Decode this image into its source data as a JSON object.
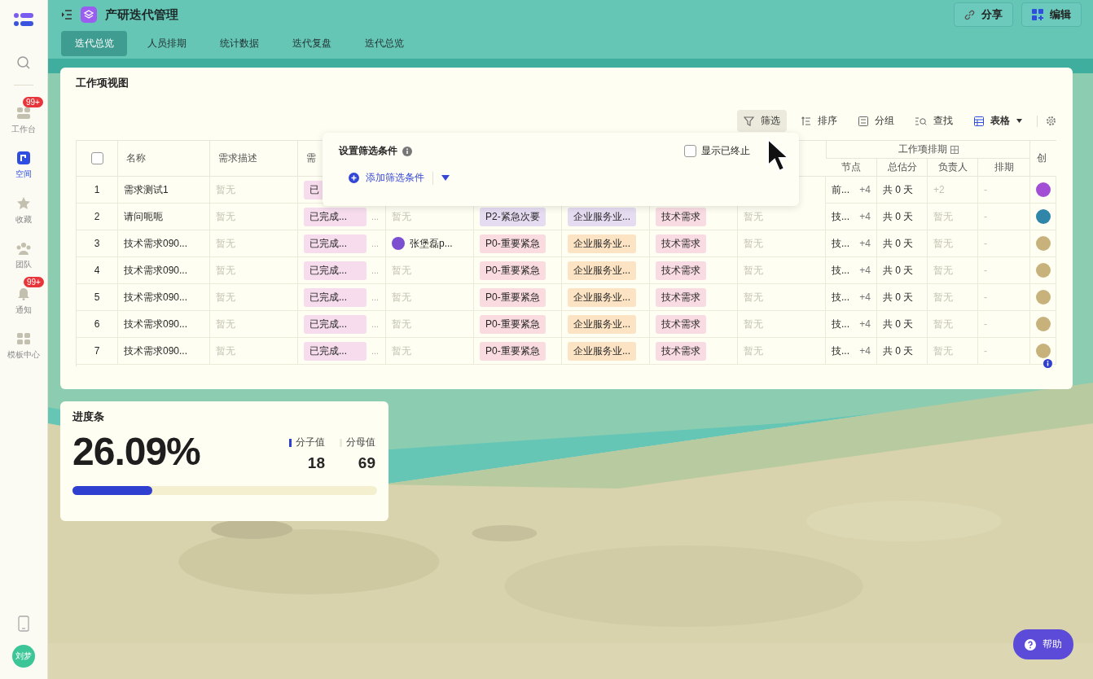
{
  "sidebar": {
    "items": [
      {
        "label": "工作台",
        "kind": "workbench",
        "badge": "99+",
        "selected": false
      },
      {
        "label": "空间",
        "kind": "space",
        "selected": true
      },
      {
        "label": "收藏",
        "kind": "favorites",
        "selected": false
      },
      {
        "label": "团队",
        "kind": "team",
        "selected": false
      },
      {
        "label": "通知",
        "kind": "notice",
        "badge": "99+",
        "selected": false
      },
      {
        "label": "模板中心",
        "kind": "templates",
        "selected": false
      }
    ],
    "user": {
      "initials": "刘梦"
    }
  },
  "header": {
    "title": "产研迭代管理",
    "tabs": [
      {
        "label": "迭代总览",
        "selected": true
      },
      {
        "label": "人员排期",
        "selected": false
      },
      {
        "label": "统计数据",
        "selected": false
      },
      {
        "label": "迭代复盘",
        "selected": false
      },
      {
        "label": "迭代总览",
        "selected": false
      }
    ],
    "buttons": [
      {
        "label": "分享",
        "kind": "share"
      },
      {
        "label": "编辑",
        "kind": "edit"
      }
    ]
  },
  "work_view": {
    "title": "工作项视图",
    "toolbar": [
      {
        "label": "筛选",
        "kind": "filter",
        "selected": true
      },
      {
        "label": "排序",
        "kind": "sort",
        "selected": false
      },
      {
        "label": "分组",
        "kind": "group",
        "selected": false
      },
      {
        "label": "查找",
        "kind": "find",
        "selected": false
      },
      {
        "label": "表格",
        "kind": "table",
        "selected": false
      }
    ],
    "table": {
      "select_all": {
        "checked": false
      },
      "columns": [
        "名称",
        "需求描述",
        "需"
      ],
      "group": {
        "label": "工作项排期",
        "columns": [
          "节点",
          "总估分",
          "负责人",
          "排期"
        ]
      },
      "column_last": "创",
      "rows": [
        {
          "index": "1",
          "name": "需求测试1",
          "description": "暂无",
          "status": "已",
          "node": "前...",
          "node_more": "+4",
          "estimate": "共 0 天",
          "owner": "+2",
          "schedule": "-",
          "creator": {
            "color": "#a24fd6"
          }
        },
        {
          "index": "2",
          "name": "请问呃呃",
          "description": "暂无",
          "status": "已完成...",
          "status_more": "...",
          "assignee": {
            "name": "暂无"
          },
          "priority": {
            "label": "P2-紧急次要",
            "color": "#e6dcf2"
          },
          "industry": {
            "label": "企业服务业...",
            "color": "#e6dcf2"
          },
          "type": {
            "label": "技术需求",
            "color": "#f9dbe4"
          },
          "extra": "暂无",
          "node": "技...",
          "node_more": "+4",
          "estimate": "共 0 天",
          "owner": "暂无",
          "schedule": "-",
          "creator": {
            "color": "#2f86a8"
          }
        },
        {
          "index": "3",
          "name": "技术需求090...",
          "description": "暂无",
          "status": "已完成...",
          "status_more": "...",
          "assignee": {
            "name": "张堡磊p...",
            "avatar": true
          },
          "priority": {
            "label": "P0-重要紧急",
            "color": "#f9dbe0"
          },
          "industry": {
            "label": "企业服务业...",
            "color": "#fce3c4"
          },
          "type": {
            "label": "技术需求",
            "color": "#f9dbe4"
          },
          "extra": "暂无",
          "node": "技...",
          "node_more": "+4",
          "estimate": "共 0 天",
          "owner": "暂无",
          "schedule": "-",
          "creator": {
            "color": "#c8b27c"
          }
        },
        {
          "index": "4",
          "name": "技术需求090...",
          "description": "暂无",
          "status": "已完成...",
          "status_more": "...",
          "assignee": {
            "name": "暂无"
          },
          "priority": {
            "label": "P0-重要紧急",
            "color": "#f9dbe0"
          },
          "industry": {
            "label": "企业服务业...",
            "color": "#fce3c4"
          },
          "type": {
            "label": "技术需求",
            "color": "#f9dbe4"
          },
          "extra": "暂无",
          "node": "技...",
          "node_more": "+4",
          "estimate": "共 0 天",
          "owner": "暂无",
          "schedule": "-",
          "creator": {
            "color": "#c8b27c"
          }
        },
        {
          "index": "5",
          "name": "技术需求090...",
          "description": "暂无",
          "status": "已完成...",
          "status_more": "...",
          "assignee": {
            "name": "暂无"
          },
          "priority": {
            "label": "P0-重要紧急",
            "color": "#f9dbe0"
          },
          "industry": {
            "label": "企业服务业...",
            "color": "#fce3c4"
          },
          "type": {
            "label": "技术需求",
            "color": "#f9dbe4"
          },
          "extra": "暂无",
          "node": "技...",
          "node_more": "+4",
          "estimate": "共 0 天",
          "owner": "暂无",
          "schedule": "-",
          "creator": {
            "color": "#c8b27c"
          }
        },
        {
          "index": "6",
          "name": "技术需求090...",
          "description": "暂无",
          "status": "已完成...",
          "status_more": "...",
          "assignee": {
            "name": "暂无"
          },
          "priority": {
            "label": "P0-重要紧急",
            "color": "#f9dbe0"
          },
          "industry": {
            "label": "企业服务业...",
            "color": "#fce3c4"
          },
          "type": {
            "label": "技术需求",
            "color": "#f9dbe4"
          },
          "extra": "暂无",
          "node": "技...",
          "node_more": "+4",
          "estimate": "共 0 天",
          "owner": "暂无",
          "schedule": "-",
          "creator": {
            "color": "#c8b27c"
          }
        },
        {
          "index": "7",
          "name": "技术需求090...",
          "description": "暂无",
          "status": "已完成...",
          "status_more": "...",
          "assignee": {
            "name": "暂无"
          },
          "priority": {
            "label": "P0-重要紧急",
            "color": "#f9dbe0"
          },
          "industry": {
            "label": "企业服务业...",
            "color": "#fce3c4"
          },
          "type": {
            "label": "技术需求",
            "color": "#f9dbe4"
          },
          "extra": "暂无",
          "node": "技...",
          "node_more": "+4",
          "estimate": "共 0 天",
          "owner": "暂无",
          "schedule": "-",
          "creator": {
            "color": "#c8b27c"
          }
        }
      ]
    },
    "filter_popup": {
      "title": "设置筛选条件",
      "show_terminated": {
        "label": "显示已终止",
        "checked": false
      },
      "add_label": "添加筛选条件"
    }
  },
  "progress": {
    "title": "进度条",
    "percent": "26.09%",
    "numerator": {
      "label": "分子值",
      "value": "18"
    },
    "denominator": {
      "label": "分母值",
      "value": "69"
    },
    "level": 0.2609
  },
  "help": {
    "label": "帮助"
  }
}
